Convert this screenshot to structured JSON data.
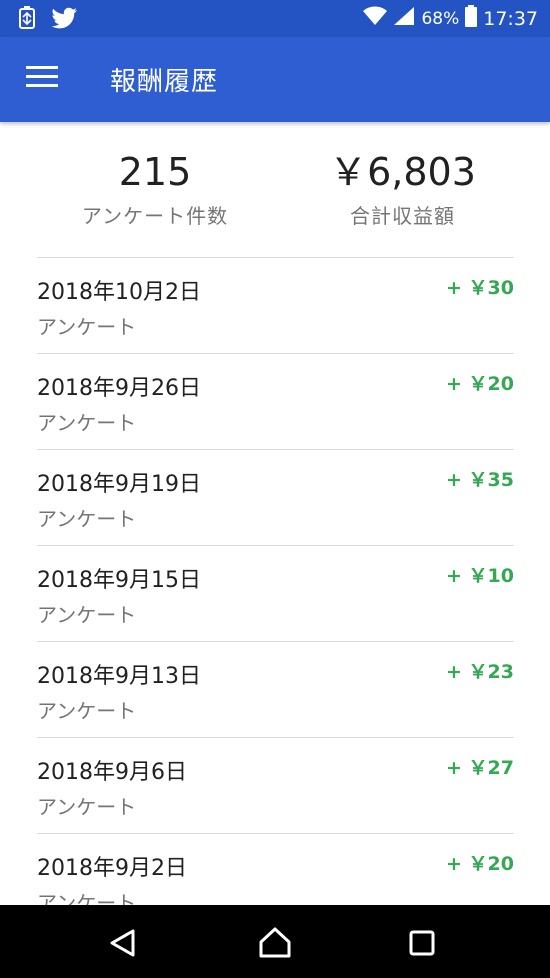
{
  "status_bar": {
    "battery_percent": "68%",
    "time": "17:37"
  },
  "app_bar": {
    "title": "報酬履歴"
  },
  "summary": {
    "survey_count": "215",
    "survey_count_label": "アンケート件数",
    "total_earnings": "￥6,803",
    "total_earnings_label": "合計収益額"
  },
  "history": [
    {
      "date": "2018年10月2日",
      "type": "アンケート",
      "amount": "+ ￥30"
    },
    {
      "date": "2018年9月26日",
      "type": "アンケート",
      "amount": "+ ￥20"
    },
    {
      "date": "2018年9月19日",
      "type": "アンケート",
      "amount": "+ ￥35"
    },
    {
      "date": "2018年9月15日",
      "type": "アンケート",
      "amount": "+ ￥10"
    },
    {
      "date": "2018年9月13日",
      "type": "アンケート",
      "amount": "+ ￥23"
    },
    {
      "date": "2018年9月6日",
      "type": "アンケート",
      "amount": "+ ￥27"
    },
    {
      "date": "2018年9月2日",
      "type": "アンケート",
      "amount": "+ ￥20"
    }
  ],
  "colors": {
    "app_bar": "#2f5ed2",
    "status_bar": "#2453c4",
    "amount_green": "#34a853"
  }
}
